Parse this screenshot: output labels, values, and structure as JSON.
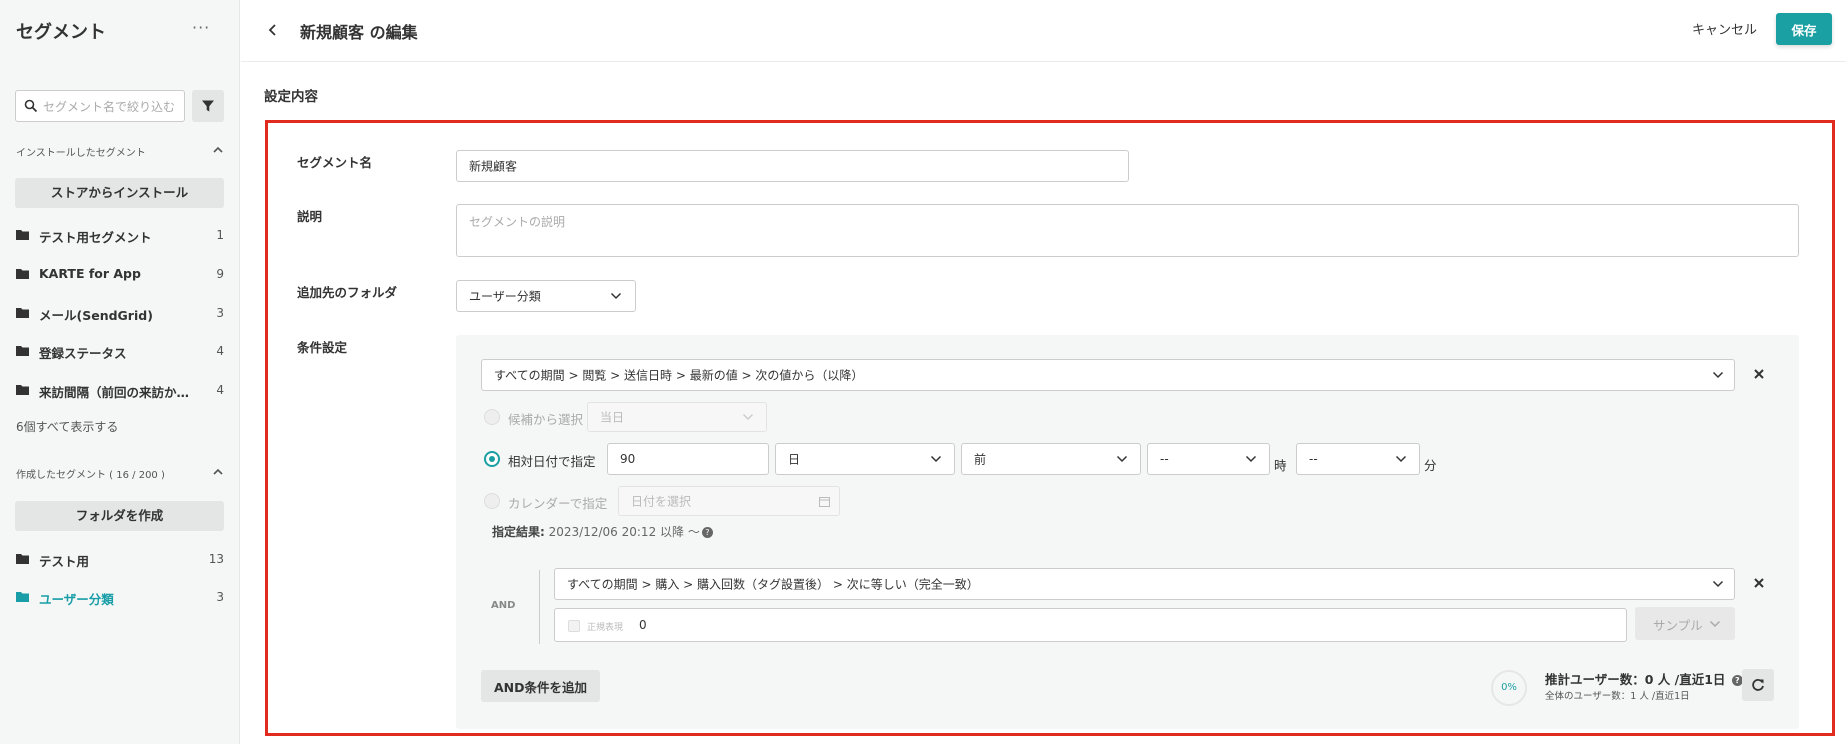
{
  "sidebar": {
    "title": "セグメント",
    "more": "···",
    "search_placeholder": "セグメント名で絞り込む",
    "installed_header": "インストールしたセグメント",
    "install_from_store": "ストアからインストール",
    "installed_folders": [
      {
        "name": "テスト用セグメント",
        "count": "1"
      },
      {
        "name": "KARTE for App",
        "count": "9"
      },
      {
        "name": "メール(SendGrid)",
        "count": "3"
      },
      {
        "name": "登録ステータス",
        "count": "4"
      },
      {
        "name": "来訪間隔（前回の来訪から…",
        "count": "4"
      }
    ],
    "show_all": "6個すべて表示する",
    "created_header": "作成したセグメント ( 16 / 200 )",
    "create_folder": "フォルダを作成",
    "created_folders": [
      {
        "name": "テスト用",
        "count": "13"
      },
      {
        "name": "ユーザー分類",
        "count": "3"
      }
    ]
  },
  "header": {
    "title": "新規顧客 の編集",
    "cancel": "キャンセル",
    "save": "保存"
  },
  "main": {
    "section_title": "設定内容",
    "segment_name_label": "セグメント名",
    "segment_name_value": "新規顧客",
    "description_label": "説明",
    "description_placeholder": "セグメントの説明",
    "folder_label": "追加先のフォルダ",
    "folder_value": "ユーザー分類",
    "condition_label": "条件設定"
  },
  "condition1": {
    "select": "すべての期間 > 閲覧 > 送信日時 > 最新の値 > 次の値から（以降）",
    "option_candidate": "候補から選択",
    "candidate_value": "当日",
    "option_relative": "相対日付で指定",
    "relative_amount": "90",
    "relative_unit": "日",
    "relative_direction": "前",
    "hour_value": "--",
    "hour_unit": "時",
    "minute_value": "--",
    "minute_unit": "分",
    "option_calendar": "カレンダーで指定",
    "calendar_placeholder": "日付を選択",
    "result_label": "指定結果:",
    "result_value": "2023/12/06 20:12 以降 〜"
  },
  "condition2": {
    "and_label": "AND",
    "select": "すべての期間 > 購入 > 購入回数（タグ設置後） > 次に等しい（完全一致）",
    "regex_label": "正規表現",
    "value": "0",
    "sample": "サンプル"
  },
  "footer": {
    "add_and": "AND条件を追加",
    "percent": "0%",
    "estimate": "推計ユーザー数：0 人 /直近1日",
    "total": "全体のユーザー数：1 人 /直近1日"
  },
  "colors": {
    "accent": "#1a9fa3",
    "highlight_border": "#e02b1e"
  }
}
